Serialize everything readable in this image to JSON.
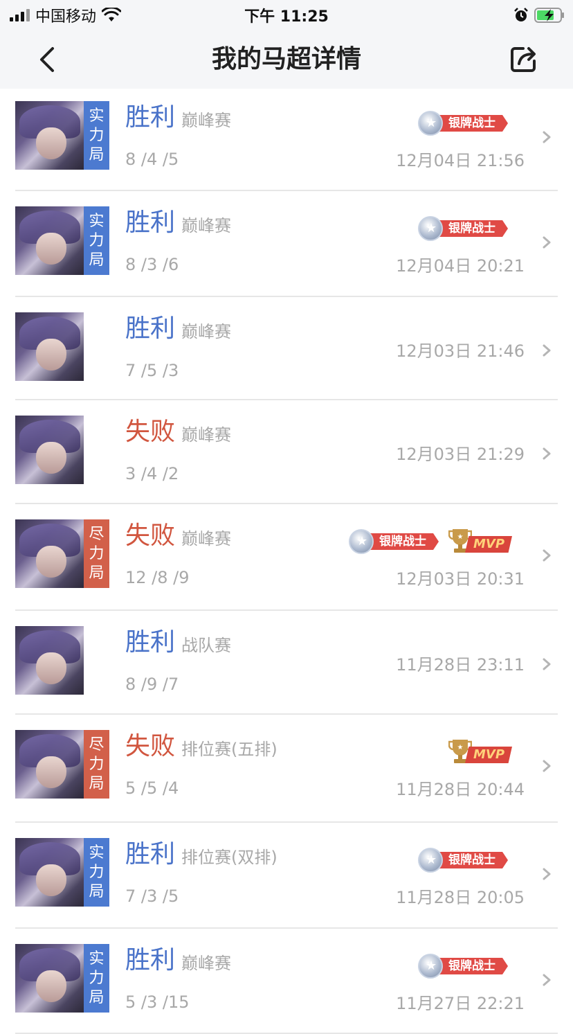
{
  "status_bar": {
    "carrier": "中国移动",
    "time": "下午 11:25"
  },
  "nav": {
    "title": "我的马超详情"
  },
  "icons": {
    "back": "chevron-left-icon",
    "share": "share-icon",
    "row_arrow": "chevron-right-icon"
  },
  "colors": {
    "win": "#4a73c9",
    "lose": "#d1563f",
    "badge_blue": "#4c7ad0",
    "badge_red": "#d2604a"
  },
  "matches": [
    {
      "result": "胜利",
      "outcome": "win",
      "mode": "巅峰赛",
      "kda": "8 /4 /5",
      "date": "12月04日 21:56",
      "badge": "实力局",
      "badge_chars": [
        "实",
        "力",
        "局"
      ],
      "badge_color": "blue",
      "medal": "银牌战士",
      "mvp": ""
    },
    {
      "result": "胜利",
      "outcome": "win",
      "mode": "巅峰赛",
      "kda": "8 /3 /6",
      "date": "12月04日 20:21",
      "badge": "实力局",
      "badge_chars": [
        "实",
        "力",
        "局"
      ],
      "badge_color": "blue",
      "medal": "银牌战士",
      "mvp": ""
    },
    {
      "result": "胜利",
      "outcome": "win",
      "mode": "巅峰赛",
      "kda": "7 /5 /3",
      "date": "12月03日 21:46",
      "badge": "",
      "badge_chars": [],
      "badge_color": "",
      "medal": "",
      "mvp": ""
    },
    {
      "result": "失败",
      "outcome": "lose",
      "mode": "巅峰赛",
      "kda": "3 /4 /2",
      "date": "12月03日 21:29",
      "badge": "",
      "badge_chars": [],
      "badge_color": "",
      "medal": "",
      "mvp": ""
    },
    {
      "result": "失败",
      "outcome": "lose",
      "mode": "巅峰赛",
      "kda": "12 /8 /9",
      "date": "12月03日 20:31",
      "badge": "尽力局",
      "badge_chars": [
        "尽",
        "力",
        "局"
      ],
      "badge_color": "red",
      "medal": "银牌战士",
      "mvp": "MVP"
    },
    {
      "result": "胜利",
      "outcome": "win",
      "mode": "战队赛",
      "kda": "8 /9 /7",
      "date": "11月28日 23:11",
      "badge": "",
      "badge_chars": [],
      "badge_color": "",
      "medal": "",
      "mvp": ""
    },
    {
      "result": "失败",
      "outcome": "lose",
      "mode": "排位赛(五排)",
      "kda": "5 /5 /4",
      "date": "11月28日 20:44",
      "badge": "尽力局",
      "badge_chars": [
        "尽",
        "力",
        "局"
      ],
      "badge_color": "red",
      "medal": "",
      "mvp": "MVP"
    },
    {
      "result": "胜利",
      "outcome": "win",
      "mode": "排位赛(双排)",
      "kda": "7 /3 /5",
      "date": "11月28日 20:05",
      "badge": "实力局",
      "badge_chars": [
        "实",
        "力",
        "局"
      ],
      "badge_color": "blue",
      "medal": "银牌战士",
      "mvp": ""
    },
    {
      "result": "胜利",
      "outcome": "win",
      "mode": "巅峰赛",
      "kda": "5 /3 /15",
      "date": "11月27日 22:21",
      "badge": "实力局",
      "badge_chars": [
        "实",
        "力",
        "局"
      ],
      "badge_color": "blue",
      "medal": "银牌战士",
      "mvp": ""
    }
  ]
}
